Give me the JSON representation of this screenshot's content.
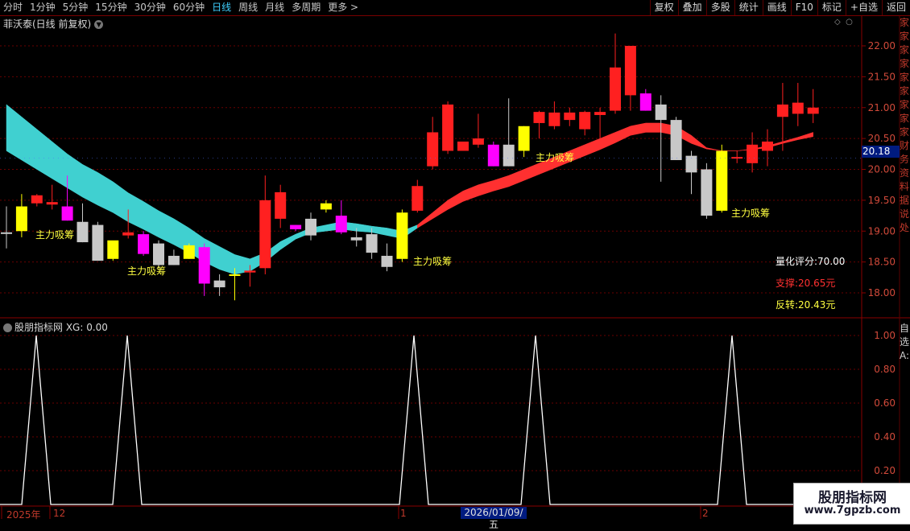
{
  "toolbar": {
    "periods": [
      "分时",
      "1分钟",
      "5分钟",
      "15分钟",
      "30分钟",
      "60分钟",
      "日线",
      "周线",
      "月线",
      "多周期",
      "更多 >"
    ],
    "active_period": "日线",
    "tools": [
      "复权",
      "叠加",
      "多股",
      "统计",
      "画线",
      "F10",
      "标记",
      "+自选",
      "返回"
    ]
  },
  "main_chart": {
    "title": "菲沃泰(日线 前复权)",
    "price_axis": [
      "22.00",
      "21.50",
      "21.00",
      "20.50",
      "20.00",
      "19.50",
      "19.00",
      "18.50",
      "18.00"
    ],
    "current_price": "20.18",
    "annotation_label": "主力吸筹",
    "info": {
      "score": "量化评分:70.00",
      "support": "支撑:20.65元",
      "reversal": "反转:20.43元"
    },
    "right_strip_text": "家家家家家家家家家财务资料据说处"
  },
  "indicator": {
    "title": "股朋指标网 XG: 0.00",
    "axis": [
      "1.00",
      "0.80",
      "0.60",
      "0.40",
      "0.20"
    ],
    "right_strip_text": "自选:A:"
  },
  "x_axis": {
    "labels": [
      "2025年",
      "12",
      "1",
      "2"
    ],
    "highlight_date": "2026/01/09/五"
  },
  "watermark": {
    "title": "股朋指标网",
    "url": "www.7gpzb.com"
  },
  "colors": {
    "up": "#ff2020",
    "down": "#c8c8c8",
    "magenta": "#ff00ff",
    "yellow": "#ffff00",
    "band_cyan": "#40d0d0",
    "band_red": "#ff3030",
    "grid": "#6a0000",
    "axis_text": "#d24a3a"
  },
  "chart_data": {
    "type": "candlestick",
    "price_range": [
      17.7,
      22.25
    ],
    "candles": [
      {
        "o": 18.98,
        "h": 19.4,
        "l": 18.72,
        "c": 18.98,
        "col": "w"
      },
      {
        "o": 19.0,
        "h": 19.6,
        "l": 18.9,
        "c": 19.4,
        "col": "y"
      },
      {
        "o": 19.45,
        "h": 19.6,
        "l": 19.4,
        "c": 19.58,
        "col": "r"
      },
      {
        "o": 19.43,
        "h": 19.75,
        "l": 19.35,
        "c": 19.47,
        "col": "r"
      },
      {
        "o": 19.4,
        "h": 19.9,
        "l": 19.17,
        "c": 19.17,
        "col": "m"
      },
      {
        "o": 19.15,
        "h": 19.45,
        "l": 18.82,
        "c": 18.82,
        "col": "g"
      },
      {
        "o": 19.1,
        "h": 19.15,
        "l": 18.52,
        "c": 18.52,
        "col": "g"
      },
      {
        "o": 18.55,
        "h": 18.7,
        "l": 18.52,
        "c": 18.85,
        "col": "y"
      },
      {
        "o": 18.93,
        "h": 19.35,
        "l": 18.88,
        "c": 18.98,
        "col": "r"
      },
      {
        "o": 18.95,
        "h": 19.0,
        "l": 18.6,
        "c": 18.63,
        "col": "m"
      },
      {
        "o": 18.8,
        "h": 18.85,
        "l": 18.4,
        "c": 18.45,
        "col": "g"
      },
      {
        "o": 18.6,
        "h": 18.7,
        "l": 18.45,
        "c": 18.45,
        "col": "g"
      },
      {
        "o": 18.55,
        "h": 18.8,
        "l": 18.55,
        "c": 18.77,
        "col": "y"
      },
      {
        "o": 18.74,
        "h": 18.8,
        "l": 17.95,
        "c": 18.15,
        "col": "m"
      },
      {
        "o": 18.2,
        "h": 18.3,
        "l": 17.95,
        "c": 18.09,
        "col": "g"
      },
      {
        "o": 18.28,
        "h": 18.4,
        "l": 17.88,
        "c": 18.3,
        "col": "y"
      },
      {
        "o": 18.33,
        "h": 18.45,
        "l": 18.1,
        "c": 18.36,
        "col": "r"
      },
      {
        "o": 18.4,
        "h": 19.9,
        "l": 18.3,
        "c": 19.5,
        "col": "r"
      },
      {
        "o": 19.2,
        "h": 19.75,
        "l": 19.05,
        "c": 19.63,
        "col": "r"
      },
      {
        "o": 19.1,
        "h": 19.1,
        "l": 19.0,
        "c": 19.03,
        "col": "m"
      },
      {
        "o": 19.2,
        "h": 19.3,
        "l": 18.85,
        "c": 18.93,
        "col": "g"
      },
      {
        "o": 19.35,
        "h": 19.5,
        "l": 19.3,
        "c": 19.45,
        "col": "y"
      },
      {
        "o": 19.25,
        "h": 19.5,
        "l": 18.95,
        "c": 18.98,
        "col": "m"
      },
      {
        "o": 18.9,
        "h": 19.05,
        "l": 18.75,
        "c": 18.85,
        "col": "g"
      },
      {
        "o": 18.95,
        "h": 19.05,
        "l": 18.55,
        "c": 18.65,
        "col": "g"
      },
      {
        "o": 18.6,
        "h": 18.8,
        "l": 18.35,
        "c": 18.42,
        "col": "g"
      },
      {
        "o": 18.55,
        "h": 19.35,
        "l": 18.5,
        "c": 19.3,
        "col": "y"
      },
      {
        "o": 19.33,
        "h": 19.83,
        "l": 19.3,
        "c": 19.73,
        "col": "r"
      },
      {
        "o": 20.05,
        "h": 20.85,
        "l": 20.0,
        "c": 20.6,
        "col": "r"
      },
      {
        "o": 20.3,
        "h": 21.1,
        "l": 20.25,
        "c": 21.05,
        "col": "r"
      },
      {
        "o": 20.3,
        "h": 20.45,
        "l": 20.3,
        "c": 20.45,
        "col": "r"
      },
      {
        "o": 20.4,
        "h": 20.9,
        "l": 20.35,
        "c": 20.5,
        "col": "r"
      },
      {
        "o": 20.4,
        "h": 20.45,
        "l": 20.05,
        "c": 20.05,
        "col": "m"
      },
      {
        "o": 20.4,
        "h": 21.15,
        "l": 20.05,
        "c": 20.05,
        "col": "g"
      },
      {
        "o": 20.3,
        "h": 20.7,
        "l": 20.2,
        "c": 20.7,
        "col": "y"
      },
      {
        "o": 20.75,
        "h": 20.95,
        "l": 20.5,
        "c": 20.93,
        "col": "r"
      },
      {
        "o": 20.7,
        "h": 21.1,
        "l": 20.65,
        "c": 20.92,
        "col": "r"
      },
      {
        "o": 20.8,
        "h": 21.0,
        "l": 20.7,
        "c": 20.92,
        "col": "r"
      },
      {
        "o": 20.65,
        "h": 20.95,
        "l": 20.55,
        "c": 20.93,
        "col": "r"
      },
      {
        "o": 20.88,
        "h": 21.0,
        "l": 20.5,
        "c": 20.93,
        "col": "r"
      },
      {
        "o": 20.95,
        "h": 22.2,
        "l": 20.9,
        "c": 21.65,
        "col": "r"
      },
      {
        "o": 21.2,
        "h": 21.85,
        "l": 20.95,
        "c": 22.0,
        "col": "r"
      },
      {
        "o": 21.23,
        "h": 21.3,
        "l": 20.95,
        "c": 20.95,
        "col": "m"
      },
      {
        "o": 21.05,
        "h": 21.2,
        "l": 19.8,
        "c": 20.8,
        "col": "g"
      },
      {
        "o": 20.8,
        "h": 20.85,
        "l": 20.15,
        "c": 20.15,
        "col": "g"
      },
      {
        "o": 20.22,
        "h": 20.3,
        "l": 19.6,
        "c": 19.95,
        "col": "g"
      },
      {
        "o": 20.0,
        "h": 20.1,
        "l": 19.2,
        "c": 19.25,
        "col": "g"
      },
      {
        "o": 19.33,
        "h": 20.4,
        "l": 19.3,
        "c": 20.3,
        "col": "y"
      },
      {
        "o": 20.18,
        "h": 20.3,
        "l": 20.1,
        "c": 20.2,
        "col": "r"
      },
      {
        "o": 20.1,
        "h": 20.6,
        "l": 19.95,
        "c": 20.4,
        "col": "r"
      },
      {
        "o": 20.3,
        "h": 20.65,
        "l": 20.05,
        "c": 20.45,
        "col": "r"
      },
      {
        "o": 20.85,
        "h": 21.4,
        "l": 20.3,
        "c": 21.05,
        "col": "r"
      },
      {
        "o": 20.9,
        "h": 21.4,
        "l": 20.7,
        "c": 21.08,
        "col": "r"
      },
      {
        "o": 20.9,
        "h": 21.3,
        "l": 20.75,
        "c": 21.0,
        "col": "r"
      }
    ],
    "band": {
      "upper": [
        21.05,
        20.85,
        20.65,
        20.45,
        20.25,
        20.08,
        19.95,
        19.8,
        19.62,
        19.48,
        19.33,
        19.2,
        19.05,
        18.88,
        18.75,
        18.62,
        18.55,
        18.65,
        18.83,
        18.95,
        19.05,
        19.1,
        19.15,
        19.12,
        19.08,
        19.05,
        19.0,
        19.1,
        19.3,
        19.5,
        19.65,
        19.75,
        19.82,
        19.9,
        20.0,
        20.1,
        20.2,
        20.3,
        20.4,
        20.5,
        20.6,
        20.7,
        20.75,
        20.75,
        20.7,
        20.55,
        20.35,
        20.3,
        20.3,
        20.33,
        20.38,
        20.45,
        20.52,
        20.6
      ],
      "lower": [
        20.3,
        20.15,
        20.0,
        19.85,
        19.7,
        19.55,
        19.42,
        19.3,
        19.15,
        19.03,
        18.9,
        18.78,
        18.65,
        18.5,
        18.38,
        18.3,
        18.35,
        18.5,
        18.7,
        18.87,
        18.97,
        19.0,
        19.03,
        19.0,
        18.98,
        18.93,
        18.88,
        19.05,
        19.2,
        19.35,
        19.48,
        19.57,
        19.65,
        19.72,
        19.82,
        19.92,
        20.02,
        20.12,
        20.22,
        20.32,
        20.43,
        20.55,
        20.6,
        20.6,
        20.55,
        20.42,
        20.33,
        20.3,
        20.3,
        20.32,
        20.35,
        20.42,
        20.48,
        20.53
      ],
      "red_from_index": 27
    },
    "signals": [
      2,
      8,
      27,
      35,
      48
    ],
    "xg_series_peaks": [
      2,
      8,
      27,
      35,
      48
    ]
  }
}
